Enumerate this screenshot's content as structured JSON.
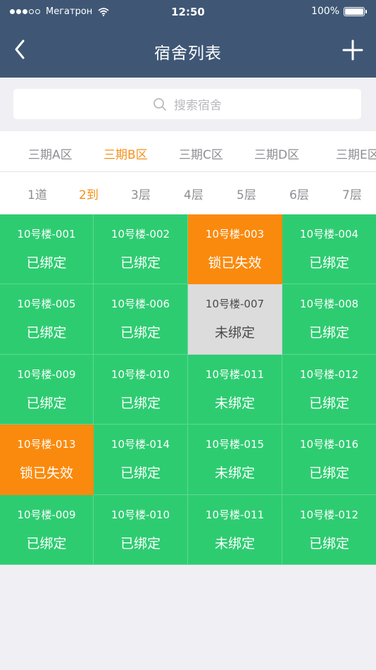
{
  "status_bar": {
    "carrier": "Мегатрон",
    "time": "12:50",
    "battery": "100%",
    "signal_bars_filled": 3,
    "signal_bars_total": 5
  },
  "nav": {
    "title": "宿舍列表",
    "back_icon": "chevron-left-icon",
    "add_icon": "plus-icon"
  },
  "search": {
    "placeholder": "搜索宿舍",
    "icon": "search-icon"
  },
  "tabs": [
    {
      "label": "三期A区",
      "active": false
    },
    {
      "label": "三期B区",
      "active": true
    },
    {
      "label": "三期C区",
      "active": false
    },
    {
      "label": "三期D区",
      "active": false
    },
    {
      "label": "三期E区",
      "active": false
    }
  ],
  "floors": [
    {
      "label": "1道",
      "active": false
    },
    {
      "label": "2到",
      "active": true
    },
    {
      "label": "3层",
      "active": false
    },
    {
      "label": "4层",
      "active": false
    },
    {
      "label": "5层",
      "active": false
    },
    {
      "label": "6层",
      "active": false
    },
    {
      "label": "7层",
      "active": false
    }
  ],
  "colors": {
    "header": "#3f5775",
    "bound_green": "#2ecc71",
    "lock_failed_orange": "#fa8a0d",
    "unbound_gray": "#dcdcdc",
    "active_tab": "#f39019"
  },
  "rooms": [
    {
      "code": "10号楼-001",
      "status": "已绑定",
      "state": "bound"
    },
    {
      "code": "10号楼-002",
      "status": "已绑定",
      "state": "bound"
    },
    {
      "code": "10号楼-003",
      "status": "锁已失效",
      "state": "failed"
    },
    {
      "code": "10号楼-004",
      "status": "已绑定",
      "state": "bound"
    },
    {
      "code": "10号楼-005",
      "status": "已绑定",
      "state": "bound"
    },
    {
      "code": "10号楼-006",
      "status": "已绑定",
      "state": "bound"
    },
    {
      "code": "10号楼-007",
      "status": "未绑定",
      "state": "unbound-gray"
    },
    {
      "code": "10号楼-008",
      "status": "已绑定",
      "state": "bound"
    },
    {
      "code": "10号楼-009",
      "status": "已绑定",
      "state": "bound"
    },
    {
      "code": "10号楼-010",
      "status": "已绑定",
      "state": "bound"
    },
    {
      "code": "10号楼-011",
      "status": "未绑定",
      "state": "unbound"
    },
    {
      "code": "10号楼-012",
      "status": "已绑定",
      "state": "bound"
    },
    {
      "code": "10号楼-013",
      "status": "锁已失效",
      "state": "failed"
    },
    {
      "code": "10号楼-014",
      "status": "已绑定",
      "state": "bound"
    },
    {
      "code": "10号楼-015",
      "status": "未绑定",
      "state": "unbound"
    },
    {
      "code": "10号楼-016",
      "status": "已绑定",
      "state": "bound"
    },
    {
      "code": "10号楼-009",
      "status": "已绑定",
      "state": "bound"
    },
    {
      "code": "10号楼-010",
      "status": "已绑定",
      "state": "bound"
    },
    {
      "code": "10号楼-011",
      "status": "未绑定",
      "state": "unbound"
    },
    {
      "code": "10号楼-012",
      "status": "已绑定",
      "state": "bound"
    }
  ]
}
